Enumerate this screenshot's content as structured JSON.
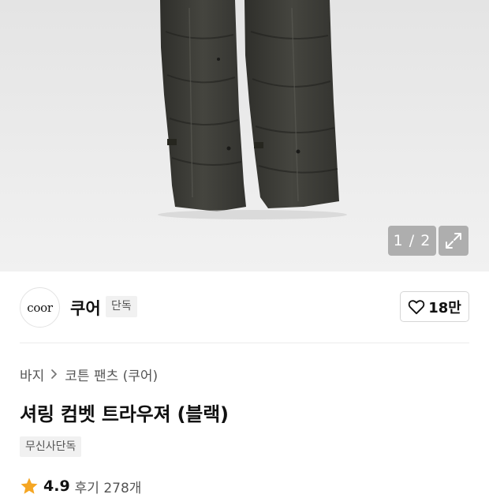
{
  "gallery": {
    "counter": "1 / 2",
    "expand_icon": "expand-icon",
    "image": "product-photo"
  },
  "brand": {
    "logo_text": "coor",
    "name": "쿠어",
    "badge": "단독",
    "like_count": "18만",
    "like_icon": "heart-outline-icon"
  },
  "breadcrumb": {
    "items": [
      "바지",
      "코튼 팬츠 (쿠어)"
    ],
    "separator_icon": "chevron-right-icon"
  },
  "product": {
    "title": "셔링 컴벳 트라우져 (블랙)",
    "tag": "무신사단독"
  },
  "rating": {
    "score": "4.9",
    "reviews": "후기 278개",
    "star_color": "#f5a623"
  }
}
